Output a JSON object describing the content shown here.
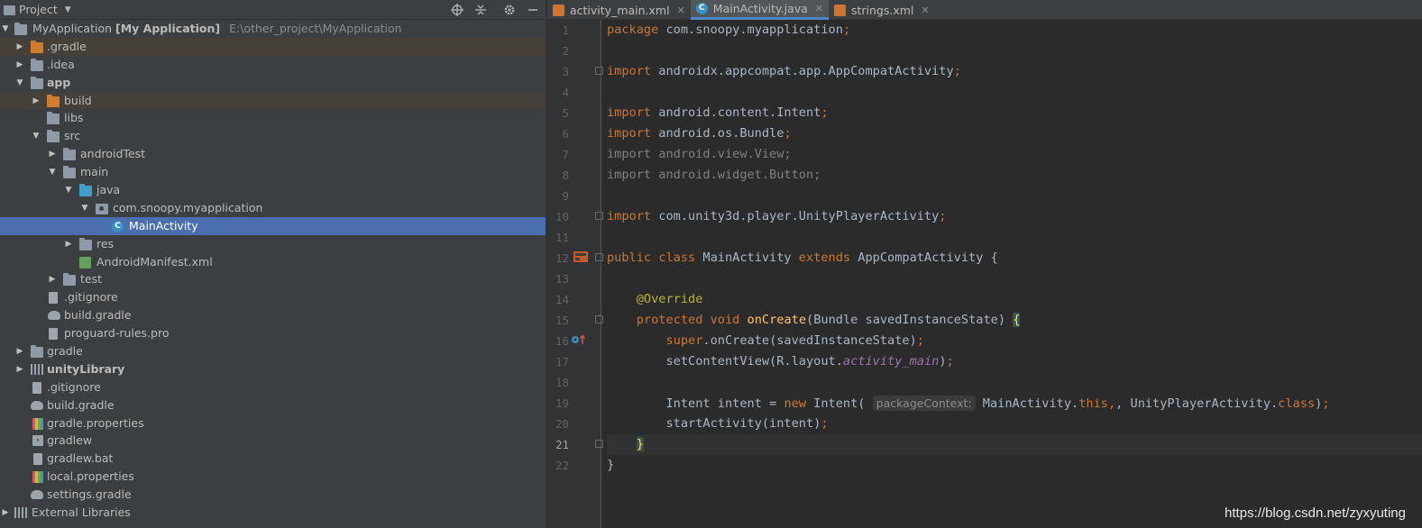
{
  "project_pane": {
    "title": "Project",
    "tree": [
      {
        "label": "MyApplication",
        "bold_suffix": "[My Application]",
        "path": "E:\\other_project\\MyApplication"
      },
      {
        "label": ".gradle"
      },
      {
        "label": ".idea"
      },
      {
        "label": "app"
      },
      {
        "label": "build"
      },
      {
        "label": "libs"
      },
      {
        "label": "src"
      },
      {
        "label": "androidTest"
      },
      {
        "label": "main"
      },
      {
        "label": "java"
      },
      {
        "label": "com.snoopy.myapplication"
      },
      {
        "label": "MainActivity"
      },
      {
        "label": "res"
      },
      {
        "label": "AndroidManifest.xml"
      },
      {
        "label": "test"
      },
      {
        "label": ".gitignore"
      },
      {
        "label": "build.gradle"
      },
      {
        "label": "proguard-rules.pro"
      },
      {
        "label": "gradle"
      },
      {
        "label": "unityLibrary"
      },
      {
        "label": ".gitignore"
      },
      {
        "label": "build.gradle"
      },
      {
        "label": "gradle.properties"
      },
      {
        "label": "gradlew"
      },
      {
        "label": "gradlew.bat"
      },
      {
        "label": "local.properties"
      },
      {
        "label": "settings.gradle"
      },
      {
        "label": "External Libraries"
      }
    ]
  },
  "tabs": [
    {
      "label": "activity_main.xml"
    },
    {
      "label": "MainActivity.java"
    },
    {
      "label": "strings.xml"
    }
  ],
  "editor": {
    "line_numbers": [
      "1",
      "2",
      "3",
      "4",
      "5",
      "6",
      "7",
      "8",
      "9",
      "10",
      "11",
      "12",
      "13",
      "14",
      "15",
      "16",
      "17",
      "18",
      "19",
      "20",
      "21",
      "22"
    ],
    "current_line": 21,
    "code": {
      "l1_kw": "package",
      "l1_rest": " com.snoopy.myapplication",
      "l3_kw": "import",
      "l3_rest": " androidx.appcompat.app.AppCompatActivity",
      "l5_kw": "import",
      "l5_rest": " android.content.Intent",
      "l6_kw": "import",
      "l6_rest": " android.os.Bundle",
      "l7": "import android.view.View;",
      "l8": "import android.widget.Button;",
      "l10_kw": "import",
      "l10_rest": " com.unity3d.player.UnityPlayerActivity",
      "l12_kw1": "public",
      "l12_kw2": "class",
      "l12_name": " MainActivity ",
      "l12_kw3": "extends",
      "l12_rest": " AppCompatActivity {",
      "l14": "@Override",
      "l15_kw1": "protected",
      "l15_kw2": "void",
      "l15_fn": "onCreate",
      "l15_rest": "(Bundle savedInstanceState) ",
      "l15_brace": "{",
      "l16_kw": "super",
      "l16_rest": ".onCreate(savedInstanceState)",
      "l17_a": "setContentView(R.layout.",
      "l17_it": "activity_main",
      "l17_b": ")",
      "l19_a": "Intent intent = ",
      "l19_kw": "new",
      "l19_b": " Intent(",
      "l19_hint": "packageContext:",
      "l19_c": " MainActivity.",
      "l19_this": "this",
      "l19_d": ", UnityPlayerActivity.",
      "l19_class": "class",
      "l19_e": ")",
      "l20": "startActivity(intent)",
      "l21": "}",
      "l22": "}",
      "semicolon": ";",
      "comma": ","
    }
  },
  "watermark": "https://blog.csdn.net/zyxyuting",
  "colors": {
    "keyword": "#cc7832",
    "annotation": "#bbb529",
    "function": "#ffc66d",
    "field": "#9876aa",
    "default_text": "#a9b7c6",
    "selection": "#4b6eaf"
  }
}
